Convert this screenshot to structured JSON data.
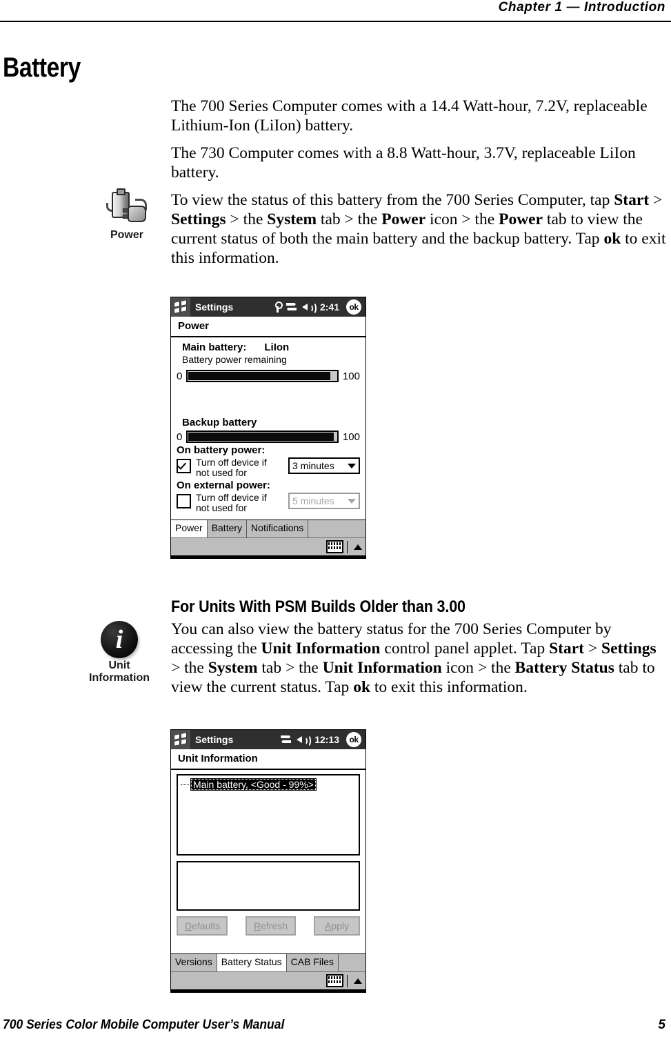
{
  "header": {
    "chapter": "Chapter 1 — Introduction"
  },
  "title": "Battery",
  "paragraphs": {
    "p1_a": "The 700 Series Computer comes with a 14.4 Watt-hour, 7.2V, replaceable Lithium-Ion (LiIon) battery.",
    "p2_a": "The 730 Computer comes with a 8.8 Watt-hour, 3.7V, replaceable LiIon battery.",
    "p3_a": "To view the status of this battery from the 700 Series Computer, tap ",
    "p3_b1": "Start",
    "p3_c": " > ",
    "p3_b2": "Settings",
    "p3_d": " > the ",
    "p3_b3": "System",
    "p3_e": " tab > the ",
    "p3_b4": "Power",
    "p3_f": " icon > the ",
    "p3_b5": "Power",
    "p3_g": " tab to view the current status of both the main battery and the backup battery. Tap ",
    "p3_b6": "ok",
    "p3_h": " to exit this information."
  },
  "power_margin_icon": {
    "label": "Power"
  },
  "unit_margin_icon": {
    "label_line1": "Unit",
    "label_line2": "Information",
    "glyph": "i"
  },
  "subhead": "For Units With PSM Builds Older than 3.00",
  "paragraph4": {
    "a": "You can also view the battery status for the 700 Series Computer by accessing the ",
    "b1": "Unit Information",
    "c": " control panel applet. Tap ",
    "b2": "Start",
    "d": " > ",
    "b3": "Settings",
    "e": " > the ",
    "b4": "System",
    "f": " tab > the ",
    "b5": "Unit Information",
    "g": " icon > the ",
    "b6": "Battery Status",
    "h": " tab to view the current status. Tap ",
    "b7": "ok",
    "i": " to exit this information."
  },
  "screenshot_power": {
    "titlebar": {
      "app": "Settings",
      "clock": "2:41",
      "ok": "ok",
      "icons": [
        "antenna-icon",
        "connectivity-icon",
        "speaker-icon"
      ]
    },
    "page_title": "Power",
    "main_battery_label": "Main battery:",
    "main_battery_type": "LiIon",
    "battery_power_remaining": "Battery power remaining",
    "main_bar": {
      "min": "0",
      "max": "100",
      "fill_percent": 96
    },
    "backup_battery_label": "Backup battery",
    "backup_bar": {
      "min": "0",
      "max": "100",
      "fill_percent": 98
    },
    "on_battery_power_label": "On battery power:",
    "on_battery_checkbox_text": "Turn off device if not used for",
    "on_battery_checked": true,
    "on_battery_timeout": "3 minutes",
    "on_external_power_label": "On external power:",
    "on_external_checkbox_text": "Turn off device if not used for",
    "on_external_checked": false,
    "on_external_timeout": "5 minutes",
    "tabs": [
      {
        "label": "Power",
        "active": true
      },
      {
        "label": "Battery",
        "active": false
      },
      {
        "label": "Notifications",
        "active": false
      }
    ]
  },
  "screenshot_unitinfo": {
    "titlebar": {
      "app": "Settings",
      "clock": "12:13",
      "ok": "ok",
      "icons": [
        "connectivity-icon",
        "speaker-icon"
      ]
    },
    "page_title": "Unit Information",
    "tree_item": "Main battery, <Good - 99%>",
    "buttons": [
      {
        "mnemonic": "D",
        "rest": "efaults"
      },
      {
        "mnemonic": "R",
        "rest": "efresh"
      },
      {
        "mnemonic": "A",
        "rest": "pply"
      }
    ],
    "tabs": [
      {
        "label": "Versions",
        "active": false
      },
      {
        "label": "Battery Status",
        "active": true
      },
      {
        "label": "CAB Files",
        "active": false
      }
    ]
  },
  "footer": {
    "manual": "700 Series Color Mobile Computer User’s Manual",
    "page": "5"
  }
}
